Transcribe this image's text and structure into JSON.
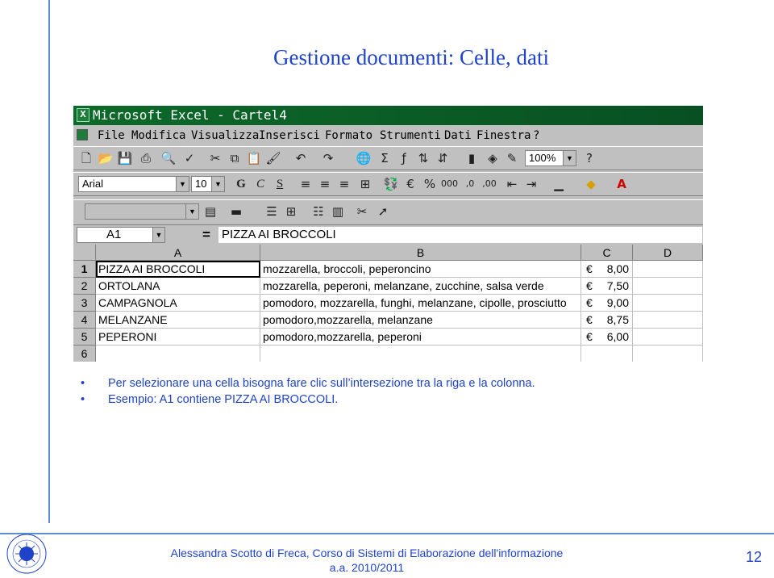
{
  "slide": {
    "title": "Gestione documenti: Celle, dati",
    "bullets": [
      "Per selezionare una cella bisogna fare clic sull’intersezione tra la riga e la colonna.",
      "Esempio: A1 contiene PIZZA AI BROCCOLI."
    ],
    "footer_line1": "Alessandra Scotto di Freca, Corso di Sistemi di Elaborazione dell'informazione",
    "footer_line2": "a.a. 2010/2011",
    "page_number": "12",
    "logo_text": "UNIVERSITA NAPOLI"
  },
  "excel": {
    "title": "Microsoft Excel - Cartel4",
    "menu": [
      "File",
      "Modifica",
      "Visualizza",
      "Inserisci",
      "Formato",
      "Strumenti",
      "Dati",
      "Finestra",
      "?"
    ],
    "zoom": "100%",
    "font_name": "Arial",
    "font_size": "10",
    "formula_bar": {
      "cell_ref": "A1",
      "equals": "=",
      "content": "PIZZA AI BROCCOLI"
    },
    "columns": [
      "A",
      "B",
      "C",
      "D"
    ],
    "rows": [
      {
        "num": "1",
        "a": "PIZZA AI BROCCOLI",
        "b": "mozzarella, broccoli, peperoncino",
        "currency": "€",
        "c": "8,00"
      },
      {
        "num": "2",
        "a": "ORTOLANA",
        "b": "mozzarella, peperoni, melanzane, zucchine, salsa verde",
        "currency": "€",
        "c": "7,50"
      },
      {
        "num": "3",
        "a": "CAMPAGNOLA",
        "b": "pomodoro, mozzarella, funghi, melanzane, cipolle, prosciutto",
        "currency": "€",
        "c": "9,00"
      },
      {
        "num": "4",
        "a": "MELANZANE",
        "b": "pomodoro,mozzarella, melanzane",
        "currency": "€",
        "c": "8,75"
      },
      {
        "num": "5",
        "a": "PEPERONI",
        "b": "pomodoro,mozzarella, peperoni",
        "currency": "€",
        "c": "6,00"
      },
      {
        "num": "6",
        "a": "",
        "b": "",
        "currency": "",
        "c": ""
      }
    ],
    "toolbar_icons": [
      "new-icon",
      "open-icon",
      "save-icon",
      "print-icon",
      "print-preview-icon",
      "spelling-icon",
      "cut-icon",
      "copy-icon",
      "paste-icon",
      "format-painter-icon",
      "undo-icon",
      "redo-icon",
      "hyperlink-icon",
      "autosum-icon",
      "function-icon",
      "sort-ascending-icon",
      "sort-descending-icon",
      "chart-wizard-icon",
      "drawing-icon",
      "help-icon"
    ]
  }
}
